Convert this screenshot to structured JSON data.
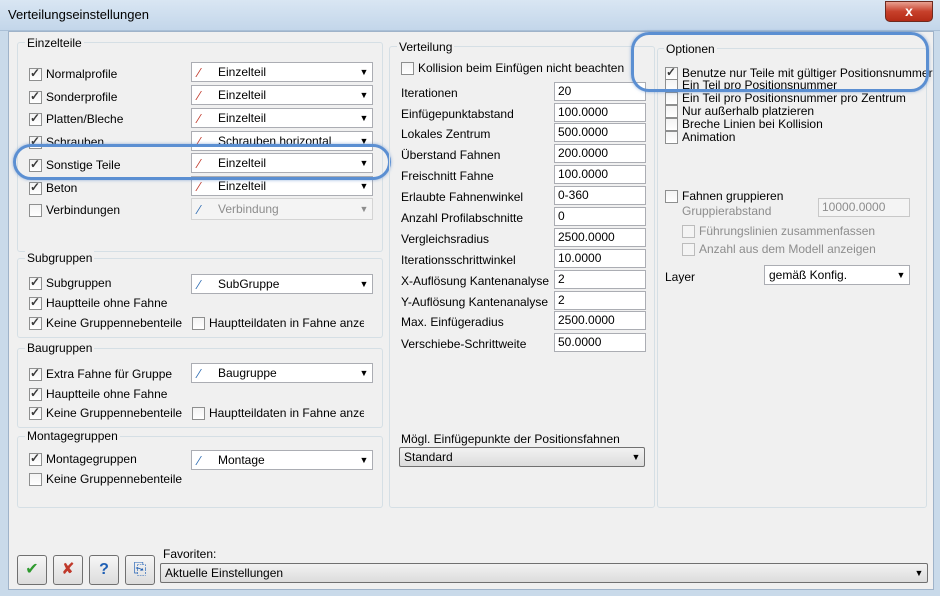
{
  "window": {
    "title": "Verteilungseinstellungen",
    "close_glyph": "x"
  },
  "einzelteile": {
    "legend": "Einzelteile",
    "rows": [
      {
        "label": "Normalprofile",
        "checked": true,
        "combo": "Einzelteil",
        "icon": "pin-icon"
      },
      {
        "label": "Sonderprofile",
        "checked": true,
        "combo": "Einzelteil",
        "icon": "pin-icon"
      },
      {
        "label": "Platten/Bleche",
        "checked": true,
        "combo": "Einzelteil",
        "icon": "pin-icon"
      },
      {
        "label": "Schrauben",
        "checked": true,
        "combo": "Schrauben horizontal",
        "icon": "pin-icon"
      },
      {
        "label": "Sonstige Teile",
        "checked": true,
        "combo": "Einzelteil",
        "icon": "pin-icon"
      },
      {
        "label": "Beton",
        "checked": true,
        "combo": "Einzelteil",
        "icon": "pin-icon"
      },
      {
        "label": "Verbindungen",
        "checked": false,
        "combo": "Verbindung",
        "icon": "pin-icon"
      }
    ]
  },
  "subgruppen": {
    "legend": "Subgruppen",
    "subgruppen_label": "Subgruppen",
    "combo": "SubGruppe",
    "hauptteile_label": "Hauptteile ohne Fahne",
    "keine_label": "Keine Gruppennebenteile",
    "hauptteildaten_label": "Hauptteildaten in Fahne anzeigen"
  },
  "baugruppen": {
    "legend": "Baugruppen",
    "extra_label": "Extra Fahne für Gruppe",
    "combo": "Baugruppe",
    "hauptteile_label": "Hauptteile ohne Fahne",
    "keine_label": "Keine Gruppennebenteile",
    "hauptteildaten_label": "Hauptteildaten in Fahne anzeigen"
  },
  "montagegruppen": {
    "legend": "Montagegruppen",
    "montage_label": "Montagegruppen",
    "combo": "Montage",
    "keine_label": "Keine Gruppennebenteile"
  },
  "verteilung": {
    "legend": "Verteilung",
    "kollision_label": "Kollision beim Einfügen nicht beachten",
    "fields": [
      {
        "label": "Iterationen",
        "value": "20"
      },
      {
        "label": "Einfügepunktabstand",
        "value": "100.0000"
      },
      {
        "label": "Lokales Zentrum",
        "value": "500.0000"
      },
      {
        "label": "Überstand Fahnen",
        "value": "200.0000"
      },
      {
        "label": "Freischnitt Fahne",
        "value": "100.0000"
      },
      {
        "label": "Erlaubte Fahnenwinkel",
        "value": "0-360"
      },
      {
        "label": "Anzahl Profilabschnitte",
        "value": "0"
      },
      {
        "label": "Vergleichsradius",
        "value": "2500.0000"
      },
      {
        "label": "Iterationsschrittwinkel",
        "value": "10.0000"
      },
      {
        "label": "X-Auflösung Kantenanalyse",
        "value": "2"
      },
      {
        "label": "Y-Auflösung Kantenanalyse",
        "value": "2"
      },
      {
        "label": "Max. Einfügeradius",
        "value": "2500.0000"
      },
      {
        "label": "Verschiebe-Schrittweite",
        "value": "50.0000"
      }
    ],
    "einfuege_label": "Mögl. Einfügepunkte der Positionsfahnen",
    "einfuege_value": "Standard"
  },
  "optionen": {
    "legend": "Optionen",
    "items": [
      {
        "label": "Benutze nur Teile mit gültiger Positionsnummer",
        "checked": true
      },
      {
        "label": "Ein Teil pro Positionsnummer",
        "checked": false
      },
      {
        "label": "Ein Teil pro Positionsnummer pro Zentrum",
        "checked": false
      },
      {
        "label": "Nur außerhalb platzieren",
        "checked": false
      },
      {
        "label": "Breche Linien bei Kollision",
        "checked": false
      },
      {
        "label": "Animation",
        "checked": false
      }
    ],
    "fahnen_label": "Fahnen gruppieren",
    "gruppierabstand_label": "Gruppierabstand",
    "gruppierabstand_value": "10000.0000",
    "fuehrungslinien_label": "Führungslinien zusammenfassen",
    "anzahl_label": "Anzahl aus dem Modell anzeigen",
    "layer_label": "Layer",
    "layer_value": "gemäß Konfig."
  },
  "footer": {
    "favoriten_label": "Favoriten:",
    "favoriten_value": "Aktuelle Einstellungen",
    "ok_glyph": "✔",
    "cancel_glyph": "✘",
    "help_glyph": "?",
    "copy_glyph": "⎘"
  },
  "colors": {
    "highlight": "#5b8fd2",
    "pin_red": "#c0392b",
    "pin_blue": "#2f6db3"
  }
}
